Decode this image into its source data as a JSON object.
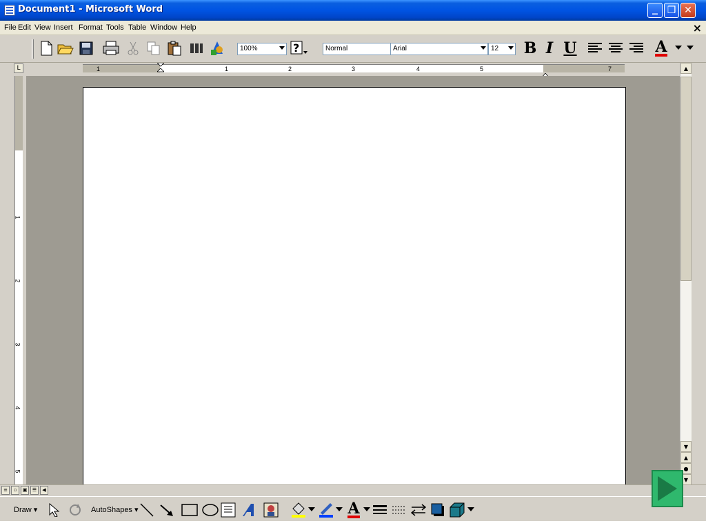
{
  "window": {
    "title": "Document1 - Microsoft Word"
  },
  "menubar": {
    "items": [
      {
        "label": "File",
        "id": "file"
      },
      {
        "label": "Edit",
        "id": "edit"
      },
      {
        "label": "View",
        "id": "view"
      },
      {
        "label": "Insert",
        "id": "insert"
      },
      {
        "label": "Format",
        "id": "format"
      },
      {
        "label": "Tools",
        "id": "tools"
      },
      {
        "label": "Table",
        "id": "table"
      },
      {
        "label": "Window",
        "id": "window"
      },
      {
        "label": "Help",
        "id": "help"
      }
    ],
    "close_symbol": "×"
  },
  "toolbar": {
    "zoom": "100%",
    "style": "Normal",
    "font": "Arial",
    "size": "12",
    "bold": "B",
    "italic": "I",
    "underline": "U",
    "font_color_glyph": "A"
  },
  "ruler": {
    "horizontal_numbers": [
      "1",
      "1",
      "2",
      "3",
      "4",
      "5",
      "7"
    ],
    "vertical_numbers": [
      "1",
      "2",
      "3",
      "4",
      "5"
    ]
  },
  "drawbar": {
    "draw_label": "Draw",
    "autoshapes_label": "AutoShapes",
    "font_color_glyph": "A"
  },
  "colors": {
    "title_bar": "#0054e3",
    "page_background": "#ffffff",
    "canvas_gray": "#9e9b92",
    "play_green": "#2fb86d"
  }
}
